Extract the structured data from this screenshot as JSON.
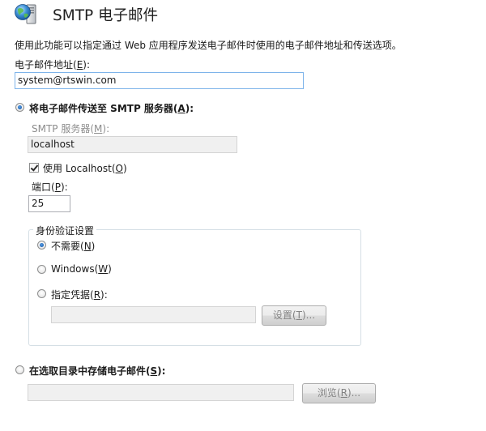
{
  "header": {
    "title": "SMTP 电子邮件",
    "icon": "globe-server-icon"
  },
  "description": "使用此功能可以指定通过 Web 应用程序发送电子邮件时使用的电子邮件地址和传送选项。",
  "email": {
    "label_prefix": "电子邮件地址(",
    "label_key": "E",
    "label_suffix": "):",
    "value": "system@rtswin.com"
  },
  "smtp_option": {
    "label_prefix": "将电子邮件传送至 SMTP 服务器(",
    "label_key": "A",
    "label_suffix": "):",
    "checked": true,
    "server": {
      "label_prefix": "SMTP 服务器(",
      "label_key": "M",
      "label_suffix": "):",
      "value": "localhost"
    },
    "use_localhost": {
      "label_prefix": "使用 Localhost(",
      "label_key": "O",
      "label_suffix": ")",
      "checked": true
    },
    "port": {
      "label_prefix": "端口(",
      "label_key": "P",
      "label_suffix": "):",
      "value": "25"
    },
    "auth": {
      "legend": "身份验证设置",
      "none": {
        "label_prefix": "不需要(",
        "label_key": "N",
        "label_suffix": ")",
        "checked": true
      },
      "windows": {
        "label_prefix": "Windows(",
        "label_key": "W",
        "label_suffix": ")",
        "checked": false
      },
      "credentials": {
        "label_prefix": "指定凭据(",
        "label_key": "R",
        "label_suffix": "):",
        "checked": false,
        "value": "",
        "button": {
          "prefix": "设置(",
          "key": "T",
          "suffix": ")..."
        }
      }
    }
  },
  "pickup_option": {
    "label_prefix": "在选取目录中存储电子邮件(",
    "label_key": "S",
    "label_suffix": "):",
    "checked": false,
    "value": "",
    "button": {
      "prefix": "浏览(",
      "key": "R",
      "suffix": ")..."
    }
  },
  "colors": {
    "accent_radio": "#1b5fae",
    "focus_border": "#7eb4ea",
    "disabled_text": "#8d8d8d"
  }
}
